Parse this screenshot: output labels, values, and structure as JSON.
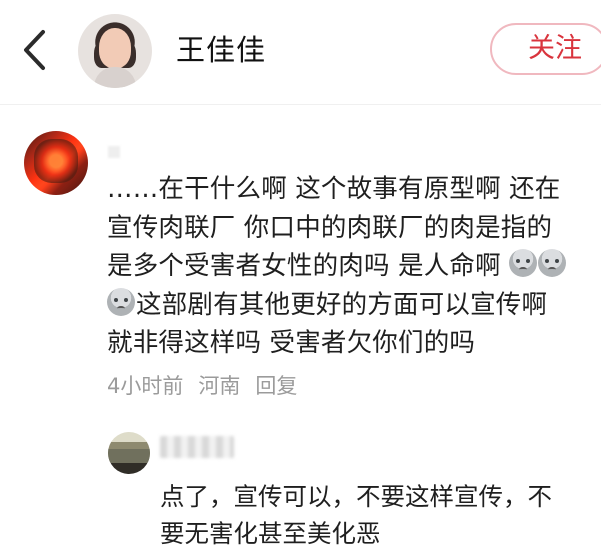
{
  "header": {
    "username": "王佳佳",
    "follow_label": "关注",
    "accent": "#d9343d"
  },
  "comment": {
    "lines": [
      "……在干什么啊 这个故事有原型啊 还在",
      "宣传肉联厂 你口中的肉联厂的肉是指的",
      "是多个受害者女性的肉吗 是人命啊 ",
      "这部剧有其他更好的方面可以宣传啊",
      "就非得这样吗 受害者欠你们的吗"
    ],
    "time": "4小时前",
    "location": "河南",
    "reply_label": "回复"
  },
  "reply": {
    "lines": [
      "点了，宣传可以，不要这样宣传，不",
      "要无害化甚至美化恶"
    ]
  },
  "icons": [
    "back-chevron-icon",
    "profile-avatar",
    "commenter-avatar",
    "reply-avatar",
    "emoji-icon"
  ]
}
